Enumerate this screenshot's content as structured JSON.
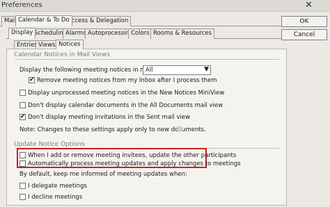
{
  "window": {
    "title": "Preferences",
    "close_glyph": "✕"
  },
  "main_tabs": [
    "Mail",
    "Calendar & To Do",
    "Access & Delegation"
  ],
  "sub_tabs": [
    "Display",
    "Scheduling",
    "Alarms",
    "Autoprocessing",
    "Colors",
    "Rooms & Resources"
  ],
  "third_tabs": [
    "Entries",
    "Views",
    "Notices"
  ],
  "buttons": {
    "ok": "OK",
    "cancel": "Cancel"
  },
  "calendar_notices": {
    "title": "Calendar Notices in Mail Views",
    "display_label": "Display the following meeting notices in my Inbox:",
    "display_select": "All",
    "remove_label": "Remove meeting notices from my Inbox after I process them",
    "unprocessed_label": "Display unprocessed meeting notices in the New Notices MiniView",
    "no_calendar_docs_label": "Don't display calendar documents in the All Documents mail view",
    "no_invitations_label": "Don't display meeting invitations in the Sent mail view",
    "note": "Note:  Changes to these settings apply only to new documents."
  },
  "update_notice": {
    "title": "Update Notice Options",
    "invitees_label": "When I add or remove meeting invitees, update the other participants",
    "auto_process_label": "Automatically process meeting updates and apply changes to meetings",
    "keep_informed": "By default, keep me informed of meeting updates when:",
    "delegate_label": "I delegate meetings",
    "decline_label": "I decline meetings"
  },
  "checks": {
    "remove": true,
    "unprocessed": false,
    "no_calendar_docs": false,
    "no_invitations": true,
    "invitees": false,
    "auto_process": false,
    "delegate": false,
    "decline": false
  },
  "colors": {
    "highlight_box": "#cc1f1f"
  }
}
